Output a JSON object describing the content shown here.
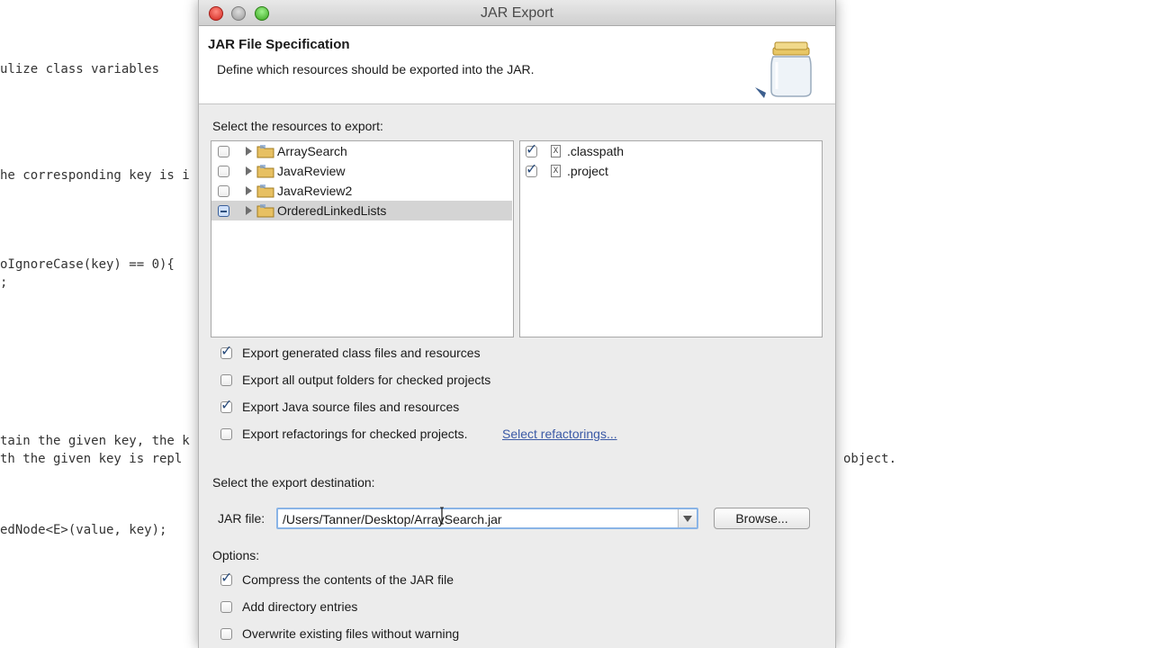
{
  "background_code": {
    "lines": [
      "ulize class variables",
      "he corresponding key is i",
      "oIgnoreCase(key) == 0){",
      ";",
      "tain the given key, the k",
      "th the given key is repl",
      "edNode<E>(value, key);",
      "object."
    ]
  },
  "window": {
    "title": "JAR Export"
  },
  "header": {
    "title": "JAR File Specification",
    "description": "Define which resources should be exported into the JAR."
  },
  "resources": {
    "label": "Select the resources to export:",
    "projects": [
      {
        "name": "ArraySearch",
        "state": "unchecked"
      },
      {
        "name": "JavaReview",
        "state": "unchecked"
      },
      {
        "name": "JavaReview2",
        "state": "unchecked"
      },
      {
        "name": "OrderedLinkedLists",
        "state": "partial"
      }
    ],
    "files": [
      {
        "name": ".classpath",
        "checked": true
      },
      {
        "name": ".project",
        "checked": true
      }
    ]
  },
  "export_options": [
    {
      "label": "Export generated class files and resources",
      "checked": true
    },
    {
      "label": "Export all output folders for checked projects",
      "checked": false
    },
    {
      "label": "Export Java source files and resources",
      "checked": true
    },
    {
      "label": "Export refactorings for checked projects.",
      "checked": false
    }
  ],
  "select_refactorings_link": "Select refactorings...",
  "destination": {
    "label": "Select the export destination:",
    "jar_file_label": "JAR file:",
    "jar_file_value": "/Users/Tanner/Desktop/ArraySearch.jar",
    "browse_label": "Browse..."
  },
  "options": {
    "label": "Options:",
    "items": [
      {
        "label": "Compress the contents of the JAR file",
        "checked": true
      },
      {
        "label": "Add directory entries",
        "checked": false
      },
      {
        "label": "Overwrite existing files without warning",
        "checked": false
      }
    ]
  },
  "colors": {
    "link": "#3b5aa6",
    "focus_ring": "#8ab4e6",
    "checkmark": "#2d4f7e"
  },
  "icons": {
    "project": "folder-icon",
    "file": "xml-file-icon",
    "jar": "jar-icon"
  }
}
